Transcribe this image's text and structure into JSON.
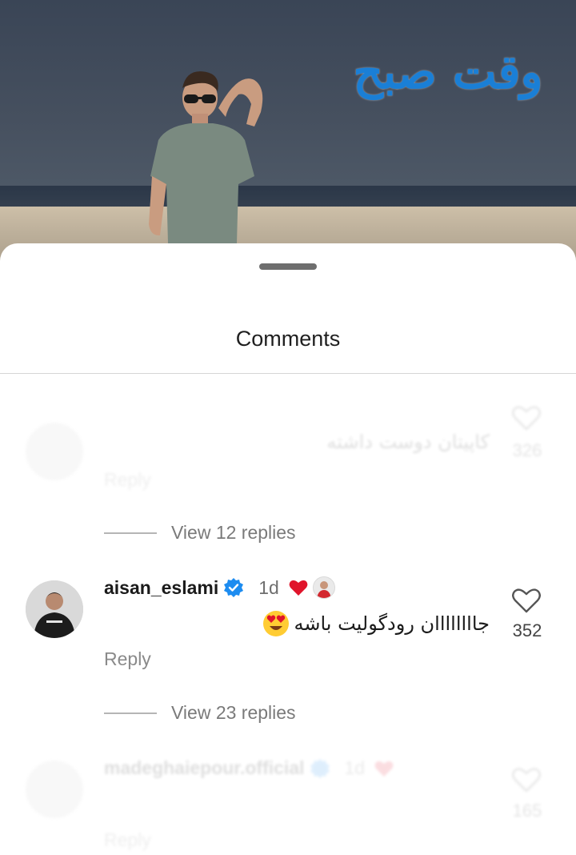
{
  "photo": {
    "watermark": "وقت صبح"
  },
  "sheet": {
    "title": "Comments"
  },
  "comments": [
    {
      "username": "",
      "time": "",
      "text": "کاپیتان دوست داشته",
      "reply": "Reply",
      "likes": "326",
      "view_replies": "View 12 replies"
    },
    {
      "username": "aisan_eslami",
      "time": "1d",
      "text": "جاااااااان رودگولیت باشه",
      "reply": "Reply",
      "likes": "352",
      "view_replies": "View 23 replies"
    },
    {
      "username": "madeghaiepour.official",
      "time": "1d",
      "text": "",
      "reply": "Reply",
      "likes": "165"
    }
  ],
  "icons": {
    "like": "heart-outline-icon",
    "verified": "verified-badge-icon",
    "reaction": "red-heart-icon",
    "emoji": "heart-eyes-emoji-icon"
  },
  "colors": {
    "verified": "#1d8cf0",
    "heart": "#e0142b",
    "watermark": "#1a7fd6"
  }
}
